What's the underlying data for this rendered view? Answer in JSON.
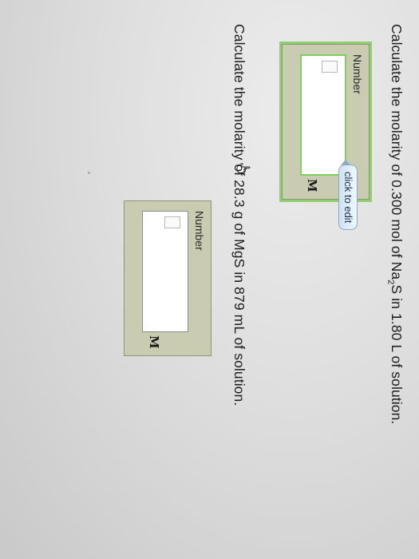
{
  "questions": [
    {
      "text_before": "Calculate the molarity of 0.300 mol of Na",
      "sub": "2",
      "text_after": "S in 1.80 L of solution.",
      "field_label": "Number",
      "field_value": "",
      "unit": "M",
      "tooltip": "click to edit"
    },
    {
      "text": "Calculate the molarity of 28.3 g of MgS in 879 mL of solution.",
      "field_label": "Number",
      "field_value": "",
      "unit": "M"
    }
  ],
  "icons": {
    "cursor": "hand-pointer-icon",
    "placeholder": "empty-box-icon"
  },
  "colors": {
    "answer_panel": "#c9ccb1",
    "focus_outline": "#8ed070",
    "tooltip_bg": "#dceaf7"
  }
}
